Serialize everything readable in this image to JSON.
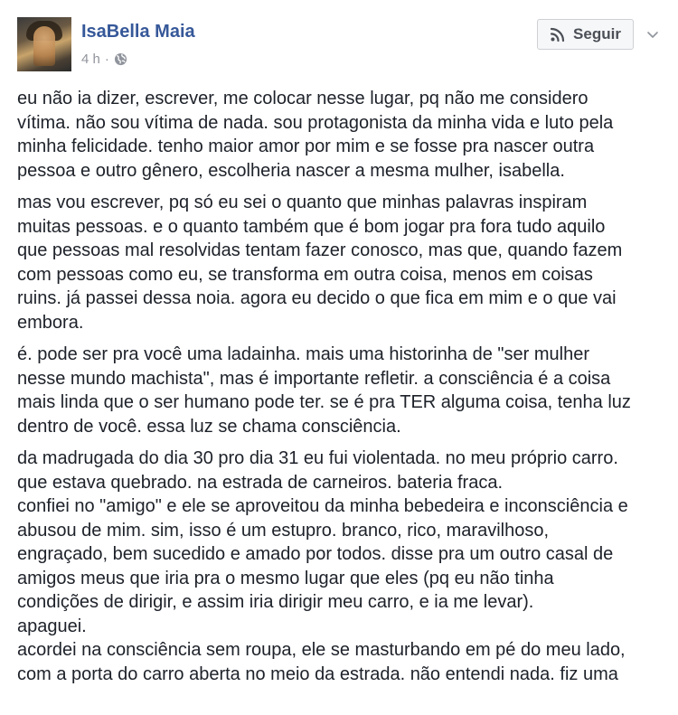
{
  "post": {
    "author": "IsaBella Maia",
    "timestamp": "4 h",
    "separator": "·",
    "privacy_icon": "globe-icon",
    "follow_label": "Seguir",
    "follow_icon": "rss-icon",
    "menu_icon": "chevron-down-icon",
    "paragraphs": [
      [
        "eu não ia dizer, escrever, me colocar nesse lugar, pq não me considero",
        "vítima. não sou vítima de nada. sou protagonista da minha vida e luto pela",
        "minha felicidade. tenho maior amor por mim e se fosse pra nascer outra",
        "pessoa e outro gênero, escolheria nascer a mesma mulher, isabella."
      ],
      [
        "mas vou escrever, pq só eu sei o quanto que minhas palavras inspiram",
        "muitas pessoas. e o quanto também que é bom jogar pra fora tudo aquilo",
        "que pessoas mal resolvidas tentam fazer conosco, mas que, quando fazem",
        "com pessoas como eu, se transforma em outra coisa, menos em coisas",
        "ruins. já passei dessa noia. agora eu decido o que fica em mim e o que vai",
        "embora."
      ],
      [
        "é. pode ser pra você uma ladainha. mais uma historinha de \"ser mulher",
        "nesse mundo machista\", mas é importante refletir. a consciência é a coisa",
        "mais linda que o ser humano pode ter. se é pra TER alguma coisa, tenha luz",
        "dentro de você. essa luz se chama consciência."
      ],
      [
        "da madrugada do dia 30 pro dia 31 eu fui violentada. no meu próprio carro.",
        "que estava quebrado. na estrada de carneiros. bateria fraca.",
        "confiei no \"amigo\" e ele se aproveitou da minha bebedeira e inconsciência e",
        "abusou de mim. sim, isso é um estupro. branco, rico, maravilhoso,",
        "engraçado, bem sucedido e amado por todos. disse pra um outro casal de",
        "amigos meus que iria pra o mesmo lugar que eles (pq eu não tinha",
        "condições de dirigir, e assim iria dirigir meu carro, e ia me levar).",
        "apaguei.",
        "acordei na consciência sem roupa, ele se masturbando em pé do meu lado,",
        "com a porta do carro aberta no meio da estrada. não entendi nada. fiz uma"
      ]
    ]
  }
}
